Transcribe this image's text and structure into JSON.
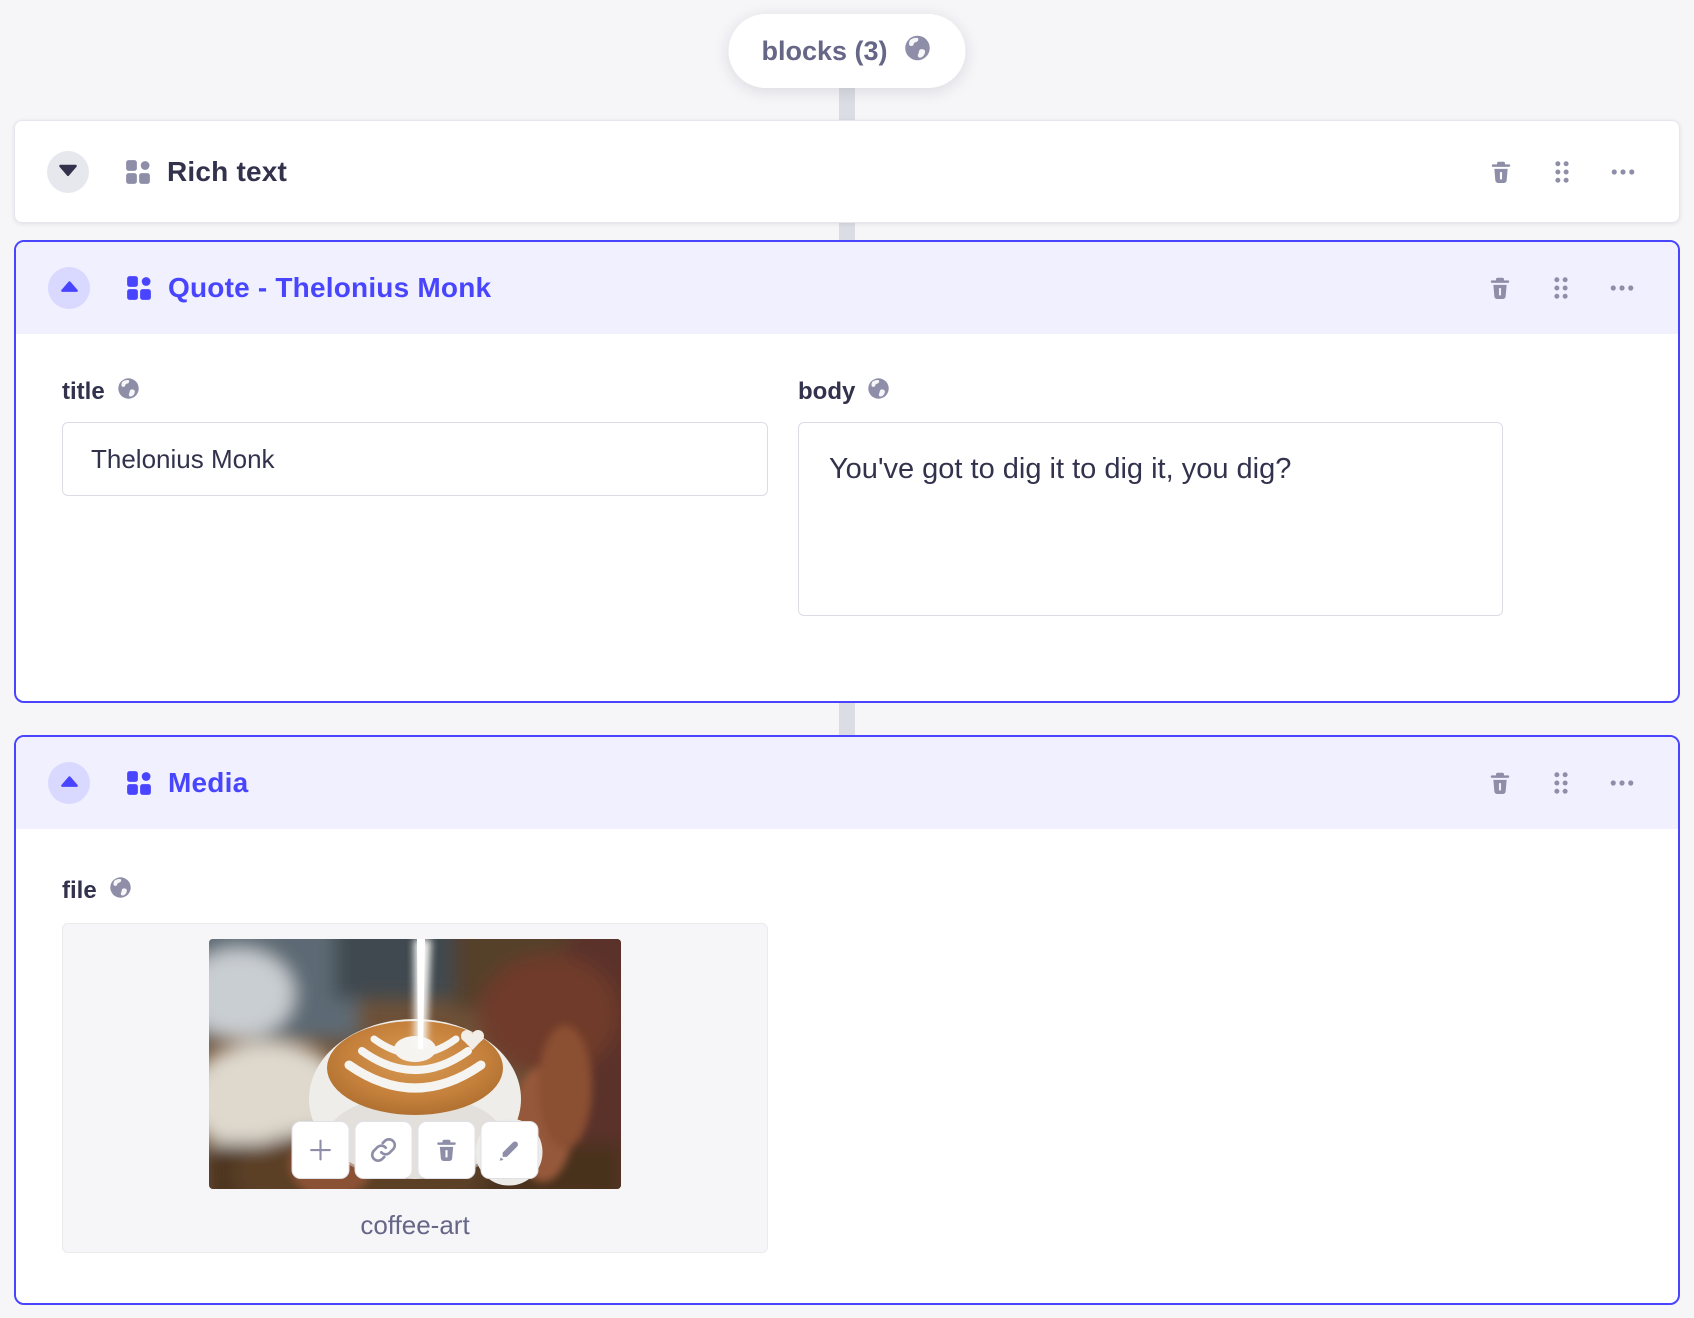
{
  "colors": {
    "accent": "#4945FF",
    "accent_bg": "#F0F0FF",
    "accent_circle": "#D9D8FF",
    "page_bg": "#F6F6F9",
    "text_dark": "#32324D",
    "text_secondary": "#666687",
    "icon_gray": "#8E8EA9",
    "border_light": "#DCDCE4"
  },
  "pill": {
    "label": "blocks (3)"
  },
  "blocks": [
    {
      "title": "Rich text",
      "state": "collapsed"
    },
    {
      "title": "Quote - Thelonius Monk",
      "state": "expanded",
      "fields": [
        {
          "label": "title",
          "type": "input",
          "value": "Thelonius Monk"
        },
        {
          "label": "body",
          "type": "textarea",
          "value": "You've got to dig it to dig it, you dig?"
        }
      ]
    },
    {
      "title": "Media",
      "state": "expanded",
      "fields": [
        {
          "label": "file",
          "type": "media",
          "file_name": "coffee-art"
        }
      ]
    }
  ]
}
